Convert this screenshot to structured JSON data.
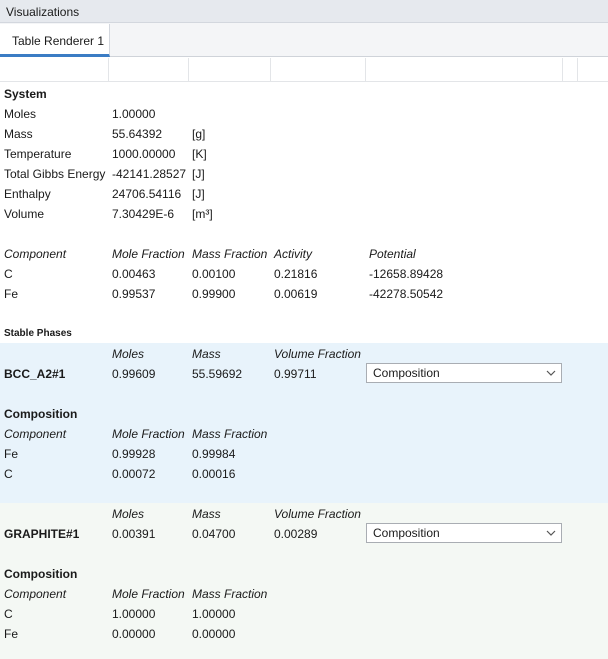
{
  "window_title": "Visualizations",
  "tab": {
    "label": "Table Renderer 1"
  },
  "system": {
    "heading": "System",
    "rows": [
      {
        "label": "Moles",
        "value": "1.00000",
        "unit": ""
      },
      {
        "label": "Mass",
        "value": "55.64392",
        "unit": "[g]"
      },
      {
        "label": "Temperature",
        "value": "1000.00000",
        "unit": "[K]"
      },
      {
        "label": "Total Gibbs Energy",
        "value": "-42141.28527",
        "unit": "[J]"
      },
      {
        "label": "Enthalpy",
        "value": "24706.54116",
        "unit": "[J]"
      },
      {
        "label": "Volume",
        "value": "7.30429E-6",
        "unit": "[m³]"
      }
    ]
  },
  "components": {
    "headers": [
      "Component",
      "Mole Fraction",
      "Mass Fraction",
      "Activity",
      "Potential"
    ],
    "rows": [
      [
        "C",
        "0.00463",
        "0.00100",
        "0.21816",
        "-12658.89428"
      ],
      [
        "Fe",
        "0.99537",
        "0.99900",
        "0.00619",
        "-42278.50542"
      ]
    ]
  },
  "stable_phases_label": "Stable Phases",
  "phases": [
    {
      "headers": [
        "Moles",
        "Mass",
        "Volume Fraction"
      ],
      "name": "BCC_A2#1",
      "moles": "0.99609",
      "mass": "55.59692",
      "volume_fraction": "0.99711",
      "select_value": "Composition",
      "composition_heading": "Composition",
      "comp_headers": [
        "Component",
        "Mole Fraction",
        "Mass Fraction"
      ],
      "comp_rows": [
        [
          "Fe",
          "0.99928",
          "0.99984"
        ],
        [
          "C",
          "0.00072",
          "0.00016"
        ]
      ]
    },
    {
      "headers": [
        "Moles",
        "Mass",
        "Volume Fraction"
      ],
      "name": "GRAPHITE#1",
      "moles": "0.00391",
      "mass": "0.04700",
      "volume_fraction": "0.00289",
      "select_value": "Composition",
      "composition_heading": "Composition",
      "comp_headers": [
        "Component",
        "Mole Fraction",
        "Mass Fraction"
      ],
      "comp_rows": [
        [
          "C",
          "1.00000",
          "1.00000"
        ],
        [
          "Fe",
          "0.00000",
          "0.00000"
        ]
      ]
    }
  ],
  "colors": {
    "phase1_bg": "#e8f3fb",
    "phase2_bg": "#f4f8f4",
    "tab_accent": "#3b7cc4"
  }
}
